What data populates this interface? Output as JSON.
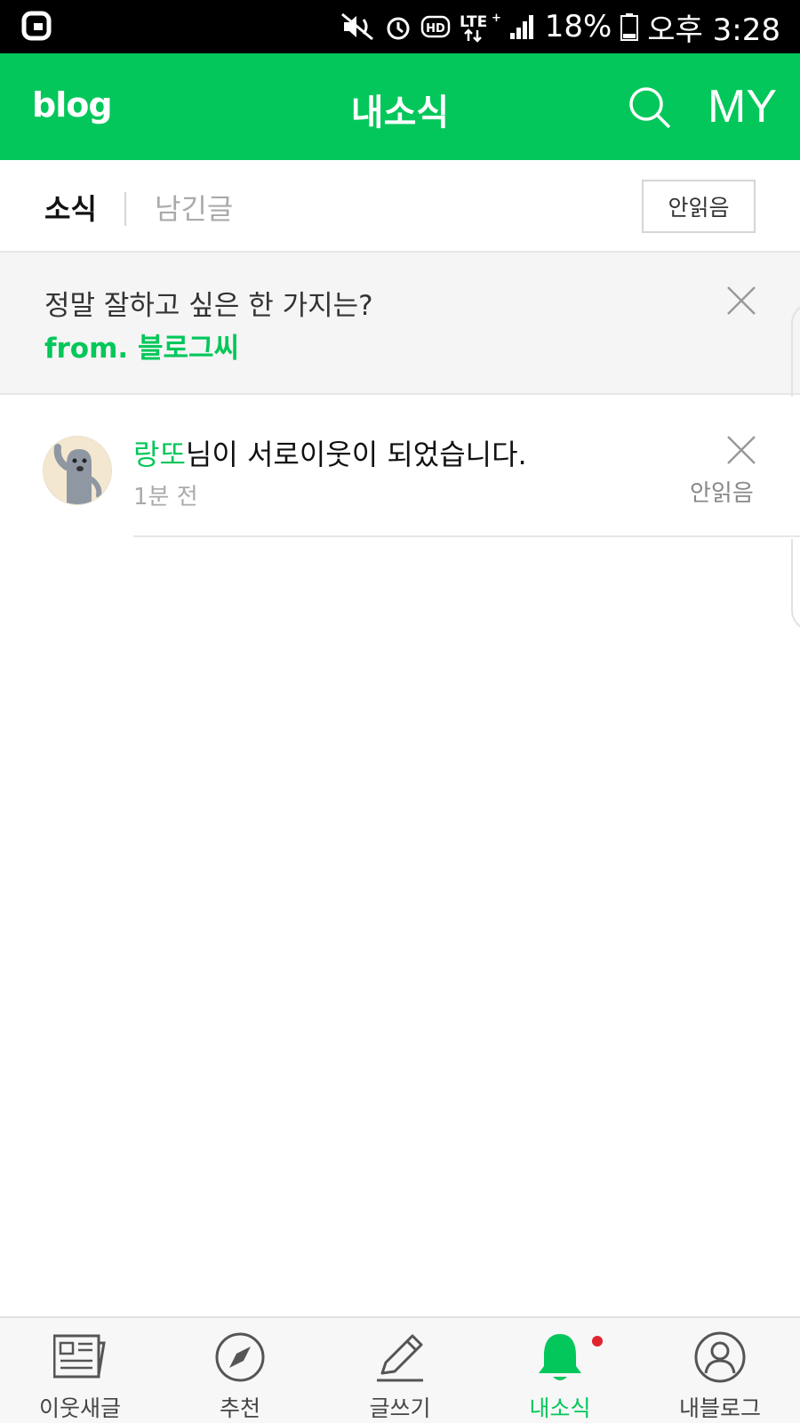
{
  "status_bar": {
    "battery": "18%",
    "time": "오후 3:28",
    "icons": [
      "carrier-logo-icon",
      "mute-icon",
      "alarm-icon",
      "hd-icon",
      "lte-plus-icon",
      "signal-icon",
      "battery-icon"
    ]
  },
  "header": {
    "logo": "blog",
    "title": "내소식",
    "my_label": "MY"
  },
  "tabs": {
    "news": "소식",
    "comments": "남긴글",
    "unread_button": "안읽음"
  },
  "banner": {
    "question": "정말 잘하고 싶은 한 가지는?",
    "from": "from. 블로그씨"
  },
  "notification": {
    "name": "랑또",
    "message": "님이 서로이웃이 되었습니다.",
    "time": "1분 전",
    "status": "안읽음"
  },
  "bottom_nav": {
    "items": [
      {
        "label": "이웃새글",
        "icon": "feed-icon"
      },
      {
        "label": "추천",
        "icon": "compass-icon"
      },
      {
        "label": "글쓰기",
        "icon": "pencil-icon"
      },
      {
        "label": "내소식",
        "icon": "bell-icon",
        "active": true,
        "has_badge": true
      },
      {
        "label": "내블로그",
        "icon": "profile-icon"
      }
    ]
  },
  "colors": {
    "accent": "#03c75a",
    "badge": "#e0252f",
    "status_bar": "#000000"
  }
}
